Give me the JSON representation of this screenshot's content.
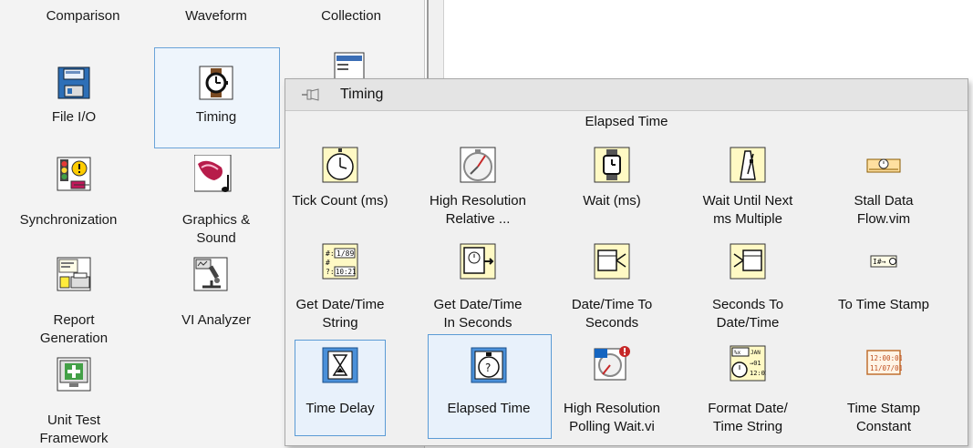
{
  "left_palette": {
    "row0": [
      "Comparison",
      "Waveform",
      "Collection"
    ],
    "items": [
      {
        "label": "File I/O",
        "icon": "floppy-disk-icon"
      },
      {
        "label": "Timing",
        "icon": "wristwatch-icon",
        "selected": true
      },
      {
        "label": "Synchronization",
        "icon": "traffic-light-icon"
      },
      {
        "label": "Graphics &\nSound",
        "icon": "graphics-sound-icon"
      },
      {
        "label": "Report\nGeneration",
        "icon": "report-printer-icon"
      },
      {
        "label": "VI Analyzer",
        "icon": "microscope-icon"
      },
      {
        "label": "Unit Test\nFramework",
        "icon": "unit-test-plus-icon"
      }
    ]
  },
  "timing_popup": {
    "title": "Timing",
    "subtitle": "Elapsed Time",
    "items": [
      {
        "label": "Tick Count (ms)",
        "icon": "stopwatch-icon"
      },
      {
        "label": "High Resolution\nRelative ...",
        "icon": "compass-clock-icon"
      },
      {
        "label": "Wait (ms)",
        "icon": "wristwatch-icon"
      },
      {
        "label": "Wait Until Next\nms Multiple",
        "icon": "metronome-icon"
      },
      {
        "label": "Stall Data\nFlow.vim",
        "icon": "stall-clock-icon"
      },
      {
        "label": "Get Date/Time\nString",
        "icon": "date-string-icon"
      },
      {
        "label": "Get Date/Time\nIn Seconds",
        "icon": "clock-seconds-icon"
      },
      {
        "label": "Date/Time To\nSeconds",
        "icon": "date-to-seconds-icon"
      },
      {
        "label": "Seconds To\nDate/Time",
        "icon": "seconds-to-date-icon"
      },
      {
        "label": "To Time Stamp",
        "icon": "to-timestamp-icon"
      },
      {
        "label": "Time Delay",
        "icon": "hourglass-icon",
        "selected": true
      },
      {
        "label": "Elapsed Time",
        "icon": "elapsed-stopwatch-icon",
        "selected": true
      },
      {
        "label": "High Resolution\nPolling Wait.vi",
        "icon": "polling-wait-icon"
      },
      {
        "label": "Format Date/\nTime String",
        "icon": "format-date-icon"
      },
      {
        "label": "Time Stamp\nConstant",
        "icon": "timestamp-constant-icon"
      }
    ],
    "timestamp_constant_text": [
      "12:00:01",
      "11/07/01"
    ]
  }
}
